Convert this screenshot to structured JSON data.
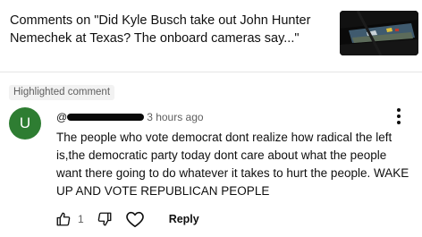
{
  "header": {
    "title": "Comments on \"Did Kyle Busch take out John Hunter Nemechek at Texas? The onboard cameras say...\""
  },
  "badge": "Highlighted comment",
  "comment": {
    "avatar_letter": "U",
    "at_symbol": "@",
    "time": "3 hours ago",
    "text": "The people who vote democrat dont realize how radical the left is,the democratic party today dont care about what the people want there going to do whatever it takes to hurt the people. WAKE UP AND VOTE REPUBLICAN PEOPLE",
    "likes": "1",
    "reply_label": "Reply",
    "avatar_color": "#2e7d32"
  },
  "icons": {
    "like": "thumbs-up-icon",
    "dislike": "thumbs-down-icon",
    "heart": "heart-icon",
    "menu": "more-vert-icon"
  }
}
